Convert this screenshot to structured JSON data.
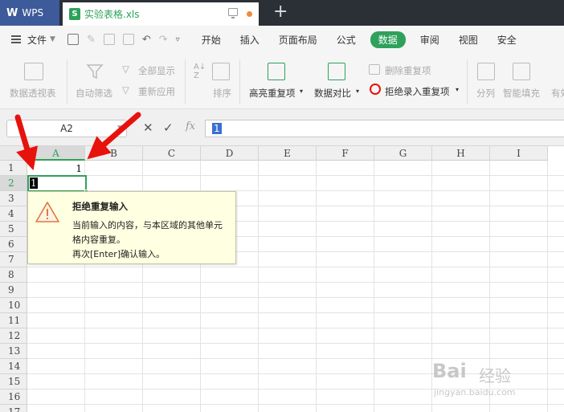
{
  "app": {
    "wps_label": "WPS",
    "doc_tab": "实验表格.xls",
    "xls_glyph": "S",
    "new_tab": "+"
  },
  "menu": {
    "file": "文件",
    "items": [
      "开始",
      "插入",
      "页面布局",
      "公式",
      "数据",
      "审阅",
      "视图",
      "安全"
    ],
    "active": "数据"
  },
  "ribbon": {
    "pivot": "数据透视表",
    "autofilter": "自动筛选",
    "show_all": "全部显示",
    "reapply": "重新应用",
    "sort": "排序",
    "highlight_dup": "高亮重复项",
    "compare": "数据对比",
    "remove_dup": "删除重复项",
    "reject_dup": "拒绝录入重复项",
    "split": "分列",
    "smart_fill": "智能填充",
    "valid_trunc": "有效"
  },
  "formula": {
    "cell_ref": "A2",
    "fx": "fx",
    "cancel": "✕",
    "confirm": "✓",
    "value": "1"
  },
  "grid": {
    "columns": [
      "A",
      "B",
      "C",
      "D",
      "E",
      "F",
      "G",
      "H",
      "I"
    ],
    "rows": [
      "1",
      "2",
      "3",
      "4",
      "5",
      "6",
      "7",
      "8",
      "9",
      "10",
      "11",
      "12",
      "13",
      "14",
      "15",
      "16",
      "17"
    ],
    "a1_value": "1",
    "a2_value": "1"
  },
  "tooltip": {
    "title": "拒绝重复输入",
    "line1": "当前输入的内容，与本区域的其他单元",
    "line2": "格内容重复。",
    "line3": "再次[Enter]确认输入。"
  },
  "watermark": {
    "logo": "Bai",
    "sub": "经验",
    "url": "jingyan.baidu.com"
  },
  "colors": {
    "accent_green": "#2ea15a",
    "arrow_red": "#e8120c",
    "tooltip_bg": "#ffffe1"
  }
}
